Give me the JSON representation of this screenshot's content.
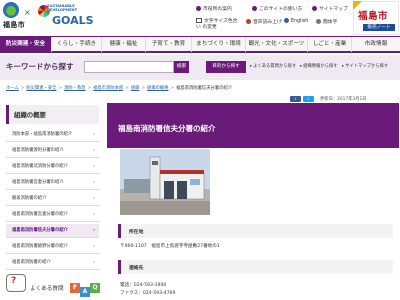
{
  "header": {
    "logo_text": "福島市",
    "sdgs_small": "SUSTAINABLE DEVELOPMENT",
    "sdgs_goals": "GOALS",
    "util_links": [
      {
        "label": "市役所の案内",
        "icon": "building-icon"
      },
      {
        "label": "このサイトの使い方",
        "icon": "info-icon"
      },
      {
        "label": "サイトマップ",
        "icon": "sitemap-icon"
      },
      {
        "label": "文字サイズ色合い の変更",
        "icon": "font-size-icon"
      },
      {
        "label": "音声読み上げ",
        "icon": "speaker-icon"
      },
      {
        "label": "English",
        "icon": "globe-icon"
      },
      {
        "label": "簡体字",
        "icon": "globe-icon"
      }
    ],
    "banner_title": "福島市",
    "banner_sub": "販売ノート"
  },
  "nav": [
    {
      "label": "防災関連・安全",
      "active": true
    },
    {
      "label": "くらし・手続き",
      "active": false
    },
    {
      "label": "健康・福祉",
      "active": false
    },
    {
      "label": "子育て・教育",
      "active": false
    },
    {
      "label": "まちづくり・環境",
      "active": false
    },
    {
      "label": "観光・文化・スポーツ",
      "active": false
    },
    {
      "label": "しごと・産業",
      "active": false
    },
    {
      "label": "市政情報",
      "active": false
    }
  ],
  "search": {
    "label": "キーワードから探す",
    "placeholder": "",
    "button": "検索",
    "purpose_button": "目的から探す",
    "quick_links": [
      "よくある質問から探す",
      "組織情報から探す",
      "サイトマップから探す"
    ]
  },
  "breadcrumb": [
    "ホーム",
    "防災関連・安全",
    "消防・救急",
    "福島市消防本部",
    "組織",
    "組織の概要",
    "福島南消防署信夫分署の紹介"
  ],
  "sidebar": {
    "title": "組織の概要",
    "items": [
      {
        "label": "消防本部・福島南消防署の紹介",
        "active": false
      },
      {
        "label": "福島消防署渡利分署の紹介",
        "active": false
      },
      {
        "label": "福島消防署北消防分署の紹介",
        "active": false
      },
      {
        "label": "福島消防署吾妻分署の紹介",
        "active": false
      },
      {
        "label": "飯坂消防署の紹介",
        "active": false
      },
      {
        "label": "福島南消防署吾妻分署の紹介",
        "active": false
      },
      {
        "label": "福島南消防署信夫分署の紹介",
        "active": true
      },
      {
        "label": "福島南消防署飯野分署の紹介",
        "active": false
      },
      {
        "label": "福島南消防署の紹介",
        "active": false
      }
    ],
    "faq_label": "よくある質問",
    "faq_blocks": [
      "F",
      "A",
      "Q"
    ]
  },
  "main": {
    "updated": "更新日：2017年3月1日",
    "title": "福島南消防署信夫分署の紹介",
    "address_heading": "所在地",
    "address": "〒960-1107　福島市上鳥渡字寺屋敷27番地の1",
    "contact_heading": "連絡先",
    "phone": "電話：024-593-1900",
    "fax": "ファクス：024-593-4769"
  },
  "colors": {
    "accent": "#6a1b7a",
    "accent_light": "#efeaf1",
    "link": "#2a63a8"
  }
}
